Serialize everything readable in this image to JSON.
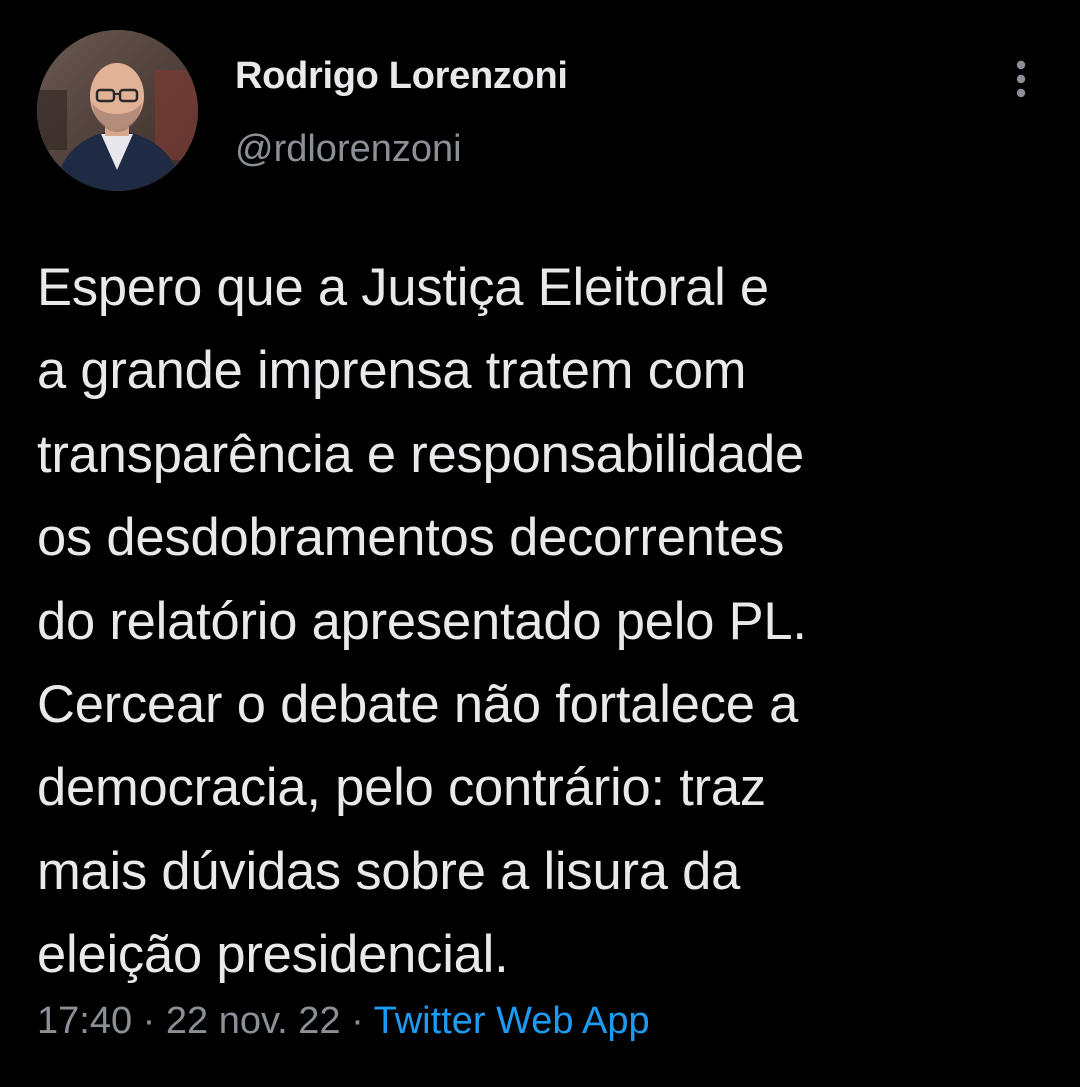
{
  "author": {
    "display_name": "Rodrigo Lorenzoni",
    "handle": "@rdlorenzoni"
  },
  "tweet": {
    "lines": [
      "Espero que a Justiça Eleitoral e",
      "a grande imprensa tratem com",
      "transparência e responsabilidade",
      "os desdobramentos decorrentes",
      "do relatório apresentado pelo PL.",
      "Cercear o debate não fortalece a",
      "democracia, pelo contrário: traz",
      "mais dúvidas sobre a lisura da",
      "eleição presidencial."
    ]
  },
  "meta": {
    "time": "17:40",
    "separator": "·",
    "date": "22 nov. 22",
    "source": "Twitter Web App"
  },
  "icons": {
    "more": "more-vertical-icon"
  },
  "colors": {
    "background": "#000000",
    "text": "#e7e9ea",
    "secondary": "#8b9096",
    "link": "#1d9bf0"
  }
}
